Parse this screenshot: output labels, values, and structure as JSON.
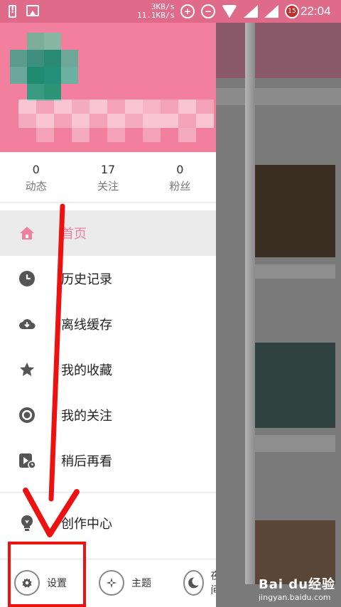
{
  "status_bar": {
    "speed_up": "3KB/s",
    "speed_down": "11.1KB/s",
    "badge_number": "15",
    "time": "22:04"
  },
  "profile": {
    "stats": [
      {
        "value": "0",
        "label": "动态"
      },
      {
        "value": "17",
        "label": "关注"
      },
      {
        "value": "0",
        "label": "粉丝"
      }
    ]
  },
  "menu": {
    "items": [
      {
        "label": "首页",
        "icon": "home-icon",
        "active": true
      },
      {
        "label": "历史记录",
        "icon": "clock-icon",
        "active": false
      },
      {
        "label": "离线缓存",
        "icon": "cloud-download-icon",
        "active": false
      },
      {
        "label": "我的收藏",
        "icon": "star-icon",
        "active": false
      },
      {
        "label": "我的关注",
        "icon": "eye-icon",
        "active": false
      },
      {
        "label": "稍后再看",
        "icon": "play-later-icon",
        "active": false
      }
    ],
    "creator_label": "创作中心"
  },
  "bottom_bar": {
    "settings_label": "设置",
    "theme_label": "主题",
    "night_label": "夜间"
  },
  "watermark": {
    "brand": "Bai du经验",
    "url": "jingyan.baidu.com"
  },
  "colors": {
    "accent": "#f27f9d",
    "annotation": "#ee1111"
  }
}
